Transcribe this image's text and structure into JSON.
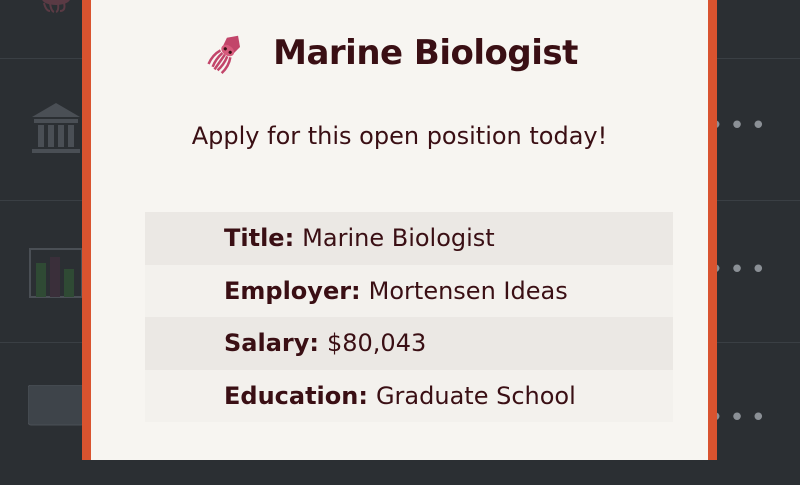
{
  "modal": {
    "icon": "squid-icon",
    "title": "Marine Biologist",
    "subtitle": "Apply for this open position today!",
    "details": [
      {
        "key": "Title:",
        "value": "Marine Biologist"
      },
      {
        "key": "Employer:",
        "value": "Mortensen Ideas"
      },
      {
        "key": "Salary:",
        "value": "$80,043"
      },
      {
        "key": "Education:",
        "value": "Graduate School"
      }
    ]
  },
  "background": {
    "rows": [
      {
        "icon": "squid-icon"
      },
      {
        "icon": "bank-icon",
        "menu": "•••"
      },
      {
        "icon": "bar-chart-icon",
        "menu": "•••"
      },
      {
        "icon": "monitor-icon",
        "menu": "•••"
      }
    ]
  },
  "colors": {
    "accent": "#d9532f",
    "text": "#3a0f14",
    "modal_bg": "#f7f5f1",
    "backdrop": "#2b2f33"
  }
}
